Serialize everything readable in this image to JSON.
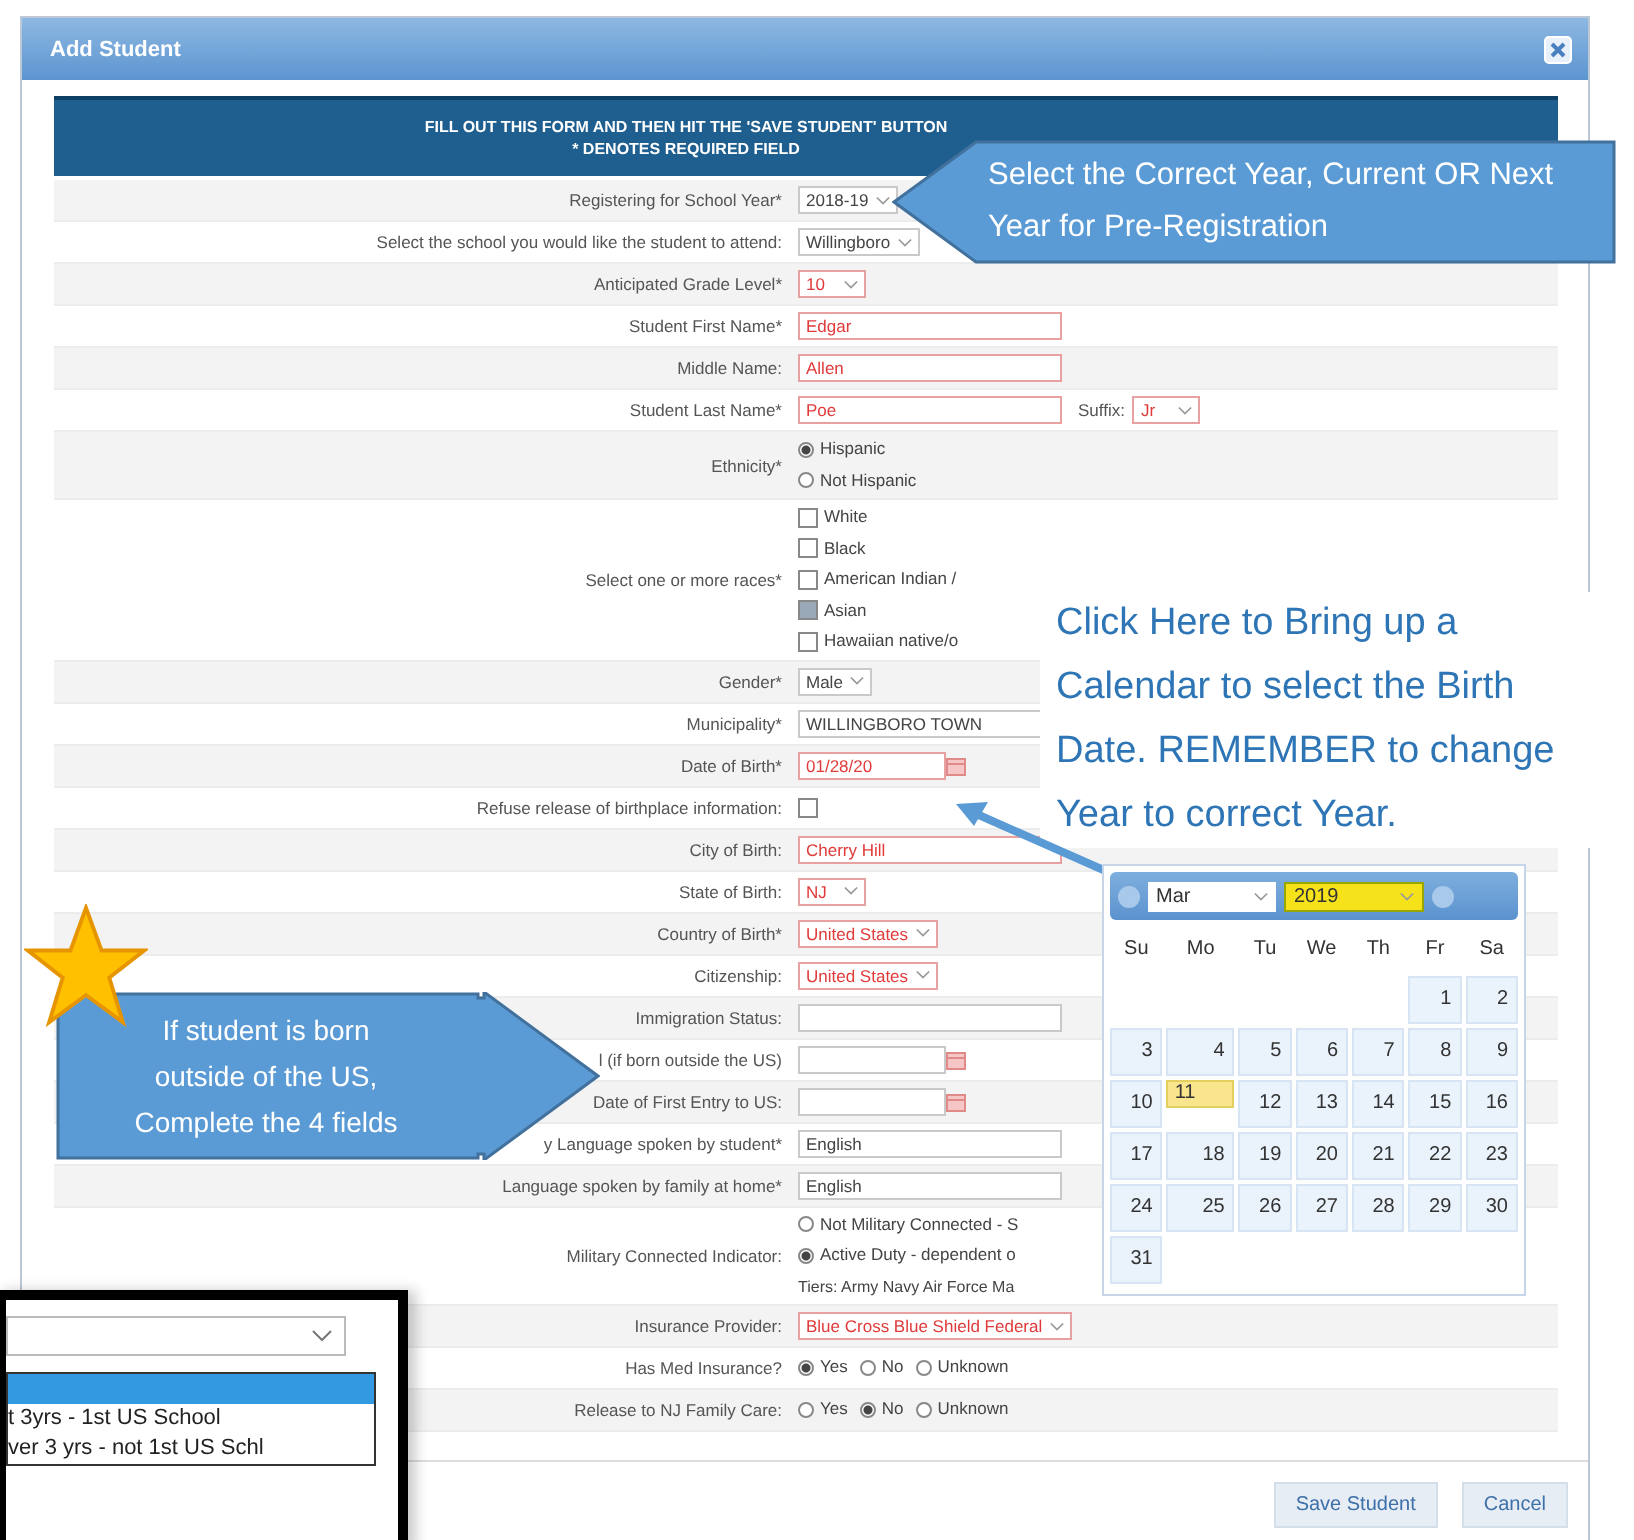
{
  "dialog": {
    "title": "Add Student"
  },
  "banner": {
    "lines": [
      "FILL OUT THIS FORM AND THEN HIT THE 'SAVE STUDENT' BUTTON",
      "* DENOTES REQUIRED FIELD"
    ]
  },
  "rows": [
    {
      "kind": "select",
      "label": "Registering for School Year*",
      "value": "2018-19",
      "highlighted": false
    },
    {
      "kind": "select",
      "label": "Select the school you would like the student to attend:",
      "value": "Willingboro",
      "highlighted": false
    },
    {
      "kind": "select",
      "label": "Anticipated Grade Level*",
      "value": "10",
      "highlighted": true
    },
    {
      "kind": "text",
      "label": "Student First Name*",
      "value": "Edgar",
      "highlighted": true
    },
    {
      "kind": "text",
      "label": "Middle Name:",
      "value": "Allen",
      "highlighted": true
    },
    {
      "kind": "text",
      "label": "Student Last Name*",
      "value": "Poe",
      "highlighted": true,
      "suffix": {
        "label": "Suffix:",
        "value": "Jr"
      }
    },
    {
      "kind": "radios",
      "label": "Ethnicity*",
      "options": [
        {
          "text": "Hispanic",
          "selected": true
        },
        {
          "text": "Not Hispanic",
          "selected": false
        }
      ]
    },
    {
      "kind": "checks",
      "label": "Select one or more races*",
      "options": [
        {
          "text": "White",
          "checked": false
        },
        {
          "text": "Black",
          "checked": false
        },
        {
          "text": "American Indian /",
          "checked": false
        },
        {
          "text": "Asian",
          "checked": true
        },
        {
          "text": "Hawaiian native/o",
          "checked": false
        }
      ]
    },
    {
      "kind": "select",
      "label": "Gender*",
      "value": "Male",
      "highlighted": false
    },
    {
      "kind": "text",
      "label": "Municipality*",
      "value": "WILLINGBORO TOWN",
      "highlighted": false
    },
    {
      "kind": "date",
      "label": "Date of Birth*",
      "value": "01/28/20",
      "highlighted": true
    },
    {
      "kind": "checkbox",
      "label": "Refuse release of birthplace information:",
      "checked": false
    },
    {
      "kind": "text",
      "label": "City of Birth:",
      "value": "Cherry Hill",
      "highlighted": true
    },
    {
      "kind": "select",
      "label": "State of Birth:",
      "value": "NJ",
      "highlighted": true
    },
    {
      "kind": "select",
      "label": "Country of Birth*",
      "value": "United States",
      "highlighted": true
    },
    {
      "kind": "select",
      "label": "Citizenship:",
      "value": "United States",
      "highlighted": true
    },
    {
      "kind": "text",
      "label": "Immigration Status:",
      "highlighted": false
    },
    {
      "kind": "date",
      "label": "l (if born outside the US)",
      "highlighted": false
    },
    {
      "kind": "date",
      "label": "Date of First Entry to US:",
      "highlighted": false
    },
    {
      "kind": "text",
      "label": "y Language spoken by student*",
      "value": "English",
      "highlighted": false
    },
    {
      "kind": "text",
      "label": "Language spoken by family at home*",
      "value": "English",
      "highlighted": false
    },
    {
      "kind": "radios",
      "label": "Military Connected Indicator:",
      "options": [
        {
          "text": "Not Military Connected - S",
          "selected": false
        },
        {
          "text": "Active Duty - dependent o",
          "selected": true
        }
      ],
      "note": "Tiers: Army Navy Air Force Ma"
    },
    {
      "kind": "select",
      "label": "Insurance Provider:",
      "value": "Blue Cross Blue Shield Federal",
      "highlighted": true
    },
    {
      "kind": "inline",
      "label": "Has Med Insurance?",
      "options": [
        {
          "text": "Yes",
          "selected": true
        },
        {
          "text": "No",
          "selected": false
        },
        {
          "text": "Unknown",
          "selected": false
        }
      ]
    },
    {
      "kind": "inline",
      "label": "Release to NJ Family Care:",
      "options": [
        {
          "text": "Yes",
          "selected": false
        },
        {
          "text": "No",
          "selected": true
        },
        {
          "text": "Unknown",
          "selected": false
        }
      ]
    }
  ],
  "buttons": [
    "Save Student",
    "Cancel"
  ],
  "callouts": {
    "year": "Select the Correct Year, Current OR Next Year for Pre-Registration",
    "calendar": "Click Here to Bring up a Calendar to select the Birth Date. REMEMBER to change Year to correct Year.",
    "outside": "If student is born outside of the US, Complete the 4 fields"
  },
  "calendar": {
    "month": "Mar",
    "year": "2019",
    "year_highlighted": true,
    "weekdays": [
      "Su",
      "Mo",
      "Tu",
      "We",
      "Th",
      "Fr",
      "Sa"
    ],
    "weeks": [
      [
        {
          "day": "1",
          "selected": false
        },
        {
          "day": "2",
          "selected": false
        }
      ],
      [
        {
          "day": "3",
          "selected": false
        },
        {
          "day": "4",
          "selected": false
        },
        {
          "day": "5",
          "selected": false
        },
        {
          "day": "6",
          "selected": false
        },
        {
          "day": "7",
          "selected": false
        },
        {
          "day": "8",
          "selected": false
        },
        {
          "day": "9",
          "selected": false
        }
      ],
      [
        {
          "day": "10",
          "selected": false
        },
        {
          "day": "11",
          "selected": true
        },
        {
          "day": "12",
          "selected": false
        },
        {
          "day": "13",
          "selected": false
        },
        {
          "day": "14",
          "selected": false
        },
        {
          "day": "15",
          "selected": false
        },
        {
          "day": "16",
          "selected": false
        }
      ],
      [
        {
          "day": "17",
          "selected": false
        },
        {
          "day": "18",
          "selected": false
        },
        {
          "day": "19",
          "selected": false
        },
        {
          "day": "20",
          "selected": false
        },
        {
          "day": "21",
          "selected": false
        },
        {
          "day": "22",
          "selected": false
        },
        {
          "day": "23",
          "selected": false
        }
      ],
      [
        {
          "day": "24",
          "selected": false
        },
        {
          "day": "25",
          "selected": false
        },
        {
          "day": "26",
          "selected": false
        },
        {
          "day": "27",
          "selected": false
        },
        {
          "day": "28",
          "selected": false
        },
        {
          "day": "29",
          "selected": false
        },
        {
          "day": "30",
          "selected": false
        }
      ],
      [
        {
          "day": "31",
          "selected": false
        }
      ]
    ]
  },
  "inset": {
    "options": [
      {
        "selected": true
      },
      {
        "text": "t 3yrs - 1st US School",
        "selected": false
      },
      {
        "text": "ver 3 yrs - not 1st US Schl",
        "selected": false
      }
    ]
  }
}
